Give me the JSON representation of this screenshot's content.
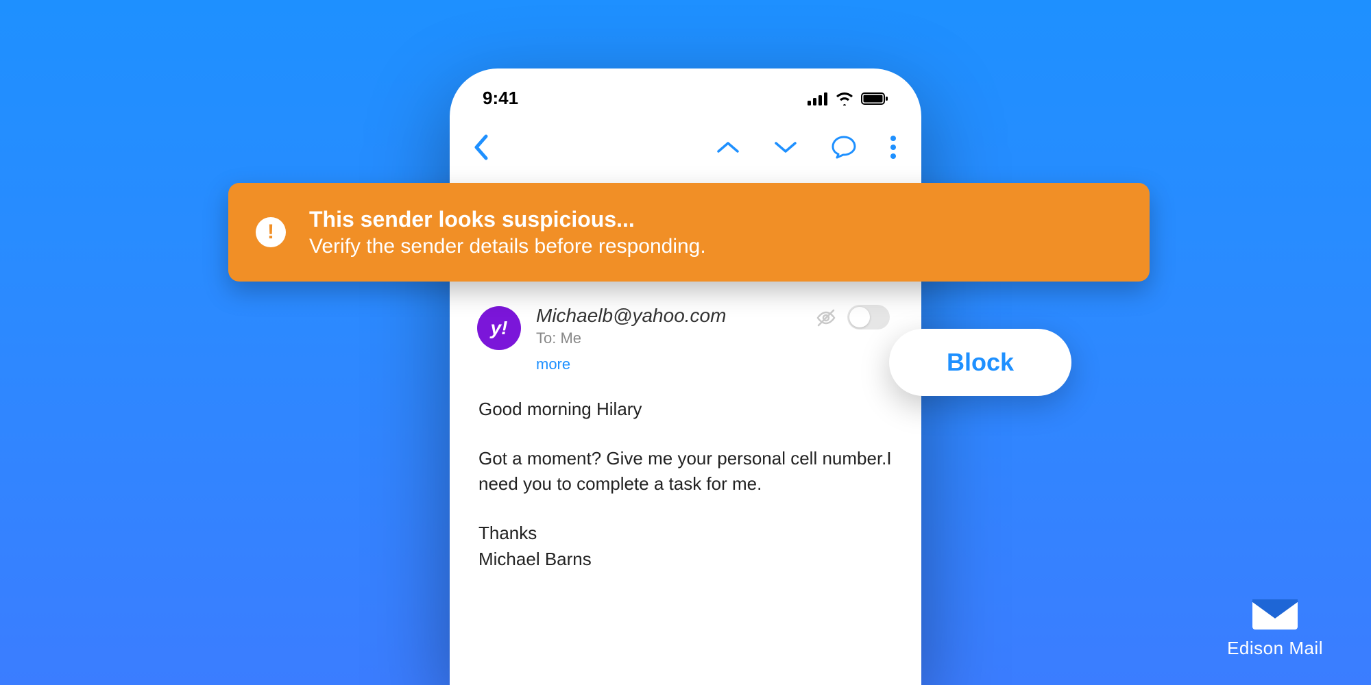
{
  "statusbar": {
    "time": "9:41"
  },
  "banner": {
    "title": "This sender looks suspicious...",
    "subtitle": "Verify the sender details before responding."
  },
  "sender": {
    "avatar_letter": "y!",
    "email": "Michaelb@yahoo.com",
    "to_line": "To: Me",
    "more_label": "more"
  },
  "email_body": {
    "greeting": "Good morning Hilary",
    "main": "Got a moment? Give me your personal cell number.I need you to complete a task for me.",
    "closing1": "Thanks",
    "closing2": "Michael Barns"
  },
  "block_button": {
    "label": "Block"
  },
  "brand": {
    "name": "Edison Mail"
  },
  "colors": {
    "accent_blue": "#1e90ff",
    "banner_orange": "#f18f26",
    "avatar_purple": "#7b16d9"
  }
}
